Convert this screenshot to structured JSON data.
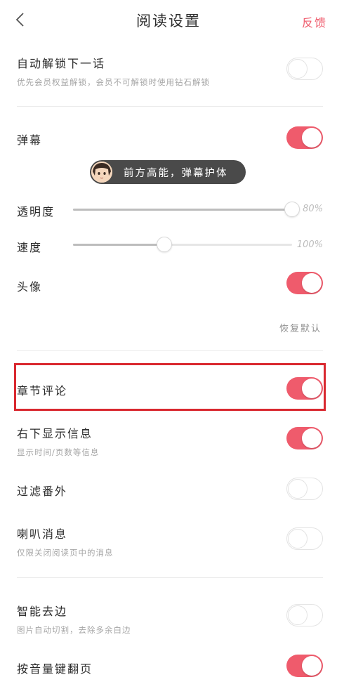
{
  "header": {
    "title": "阅读设置",
    "feedback": "反馈"
  },
  "auto_unlock": {
    "label": "自动解锁下一话",
    "sub": "优先会员权益解锁，会员不可解锁时使用钻石解锁",
    "enabled": false
  },
  "danmaku": {
    "label": "弹幕",
    "enabled": true,
    "preview_text": "前方高能，弹幕护体",
    "opacity": {
      "label": "透明度",
      "value_text": "80%",
      "level": 1.0
    },
    "speed": {
      "label": "速度",
      "value_text": "100%",
      "level": 0.42
    },
    "avatar": {
      "label": "头像",
      "enabled": true
    },
    "restore": "恢复默认"
  },
  "chapter_comments": {
    "label": "章节评论",
    "enabled": true
  },
  "bottom_right_info": {
    "label": "右下显示信息",
    "sub": "显示时间/页数等信息",
    "enabled": true
  },
  "filter_extras": {
    "label": "过滤番外",
    "enabled": false
  },
  "horn_messages": {
    "label": "喇叭消息",
    "sub": "仅限关闭阅读页中的消息",
    "enabled": false
  },
  "smart_crop": {
    "label": "智能去边",
    "sub": "图片自动切割，去除多余白边",
    "enabled": false
  },
  "volume_turn": {
    "label": "按音量键翻页",
    "enabled": true
  },
  "colors": {
    "accent": "#ef5b6c",
    "highlight_border": "#d9282f"
  }
}
